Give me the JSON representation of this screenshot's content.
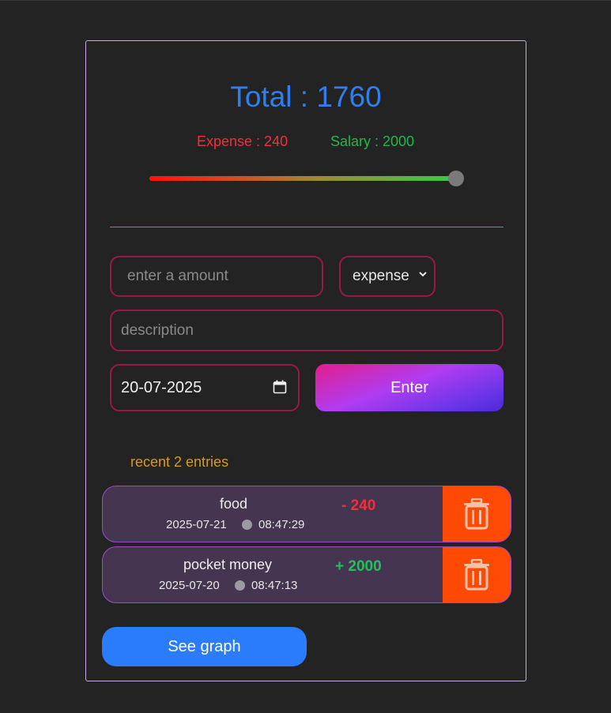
{
  "summary": {
    "total_label": "Total : 1760",
    "expense_label": "Expense : 240",
    "salary_label": "Salary : 2000",
    "balance_ratio": 1.0,
    "colors": {
      "total": "#2f7ff0",
      "expense": "#f0303a",
      "salary": "#1fb94a"
    }
  },
  "form": {
    "amount_placeholder": "enter a amount",
    "type_selected": "expense",
    "description_placeholder": "description",
    "date_value": "20-07-2025",
    "enter_label": "Enter"
  },
  "recent": {
    "heading": "recent 2 entries",
    "entries": [
      {
        "title": "food",
        "date": "2025-07-21",
        "time": "08:47:29",
        "amount": "- 240",
        "kind": "expense",
        "color": "#f0303a"
      },
      {
        "title": "pocket money",
        "date": "2025-07-20",
        "time": "08:47:13",
        "amount": "+ 2000",
        "kind": "salary",
        "color": "#1fc25a"
      }
    ]
  },
  "icons": {
    "delete": "trash-icon",
    "clock": "clock-icon",
    "calendar": "calendar-icon",
    "dropdown": "chevron-down-icon"
  },
  "see_graph_label": "See graph"
}
